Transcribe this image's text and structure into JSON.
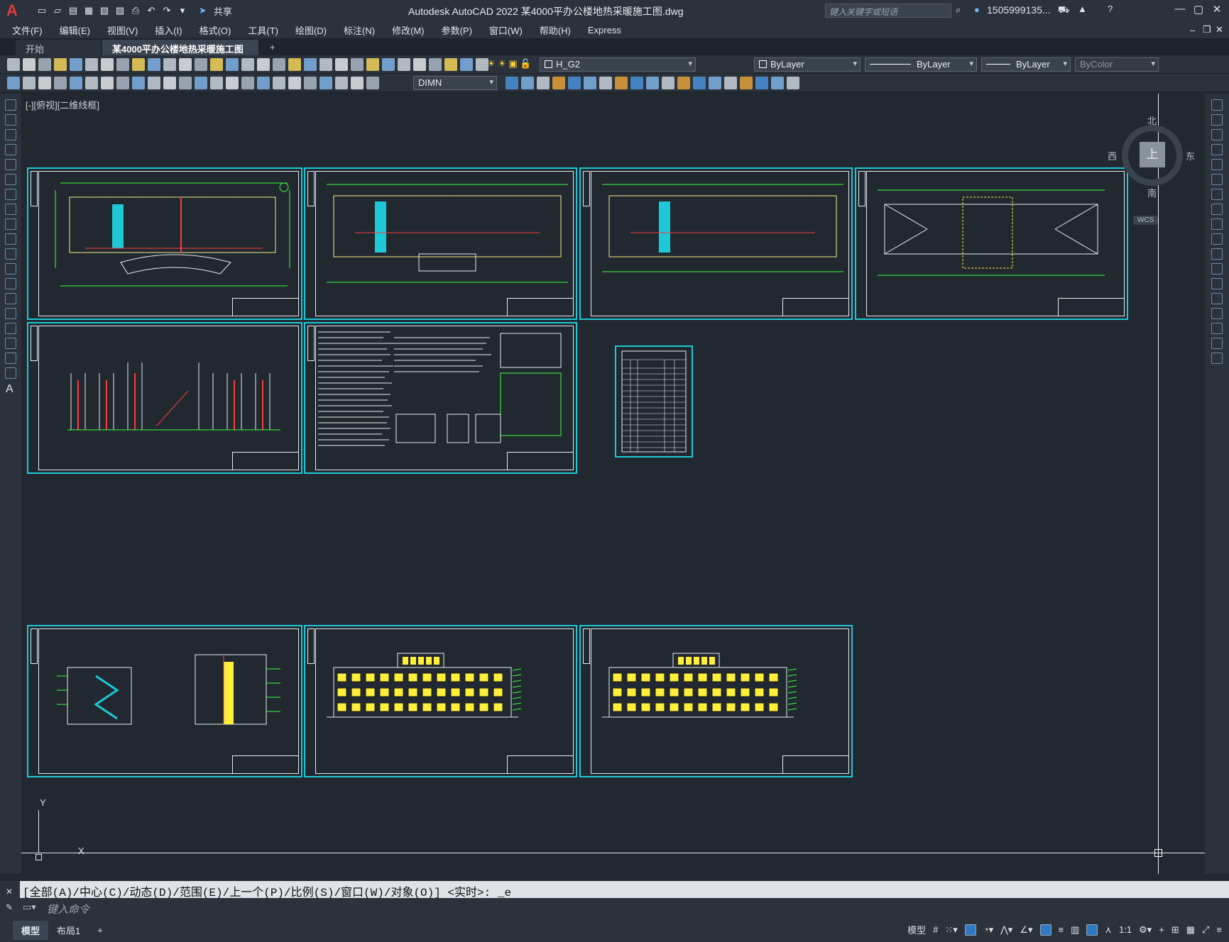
{
  "titlebar": {
    "app_logo": "A",
    "share_label": "共享",
    "window_title": "Autodesk AutoCAD 2022    某4000平办公楼地热采暖施工图.dwg",
    "search_placeholder": "键入关键字或短语",
    "user_name": "1505999135..."
  },
  "menu": [
    "文件(F)",
    "编辑(E)",
    "视图(V)",
    "插入(I)",
    "格式(O)",
    "工具(T)",
    "绘图(D)",
    "标注(N)",
    "修改(M)",
    "参数(P)",
    "窗口(W)",
    "帮助(H)",
    "Express"
  ],
  "tabs": {
    "start": "开始",
    "active": "某4000平办公楼地热采暖施工图*",
    "close": "×",
    "add": "+"
  },
  "toolbar": {
    "layer": "H_G2",
    "color": "ByLayer",
    "linetype": "ByLayer",
    "lineweight": "ByLayer",
    "plotstyle": "ByColor",
    "dimstyle": "DIMN"
  },
  "viewport": {
    "label": "[-][俯视][二维线框]",
    "navcube": {
      "north": "北",
      "south": "南",
      "east": "东",
      "west": "西",
      "top": "上",
      "wcs": "WCS"
    },
    "ucs": {
      "x": "X",
      "y": "Y"
    }
  },
  "command": {
    "history": "[全部(A)/中心(C)/动态(D)/范围(E)/上一个(P)/比例(S)/窗口(W)/对象(O)] <实时>: _e",
    "placeholder": "键入命令"
  },
  "status": {
    "model_tab": "模型",
    "layout_tab": "布局1",
    "add_tab": "+",
    "model_label": "模型",
    "scale": "1:1"
  }
}
